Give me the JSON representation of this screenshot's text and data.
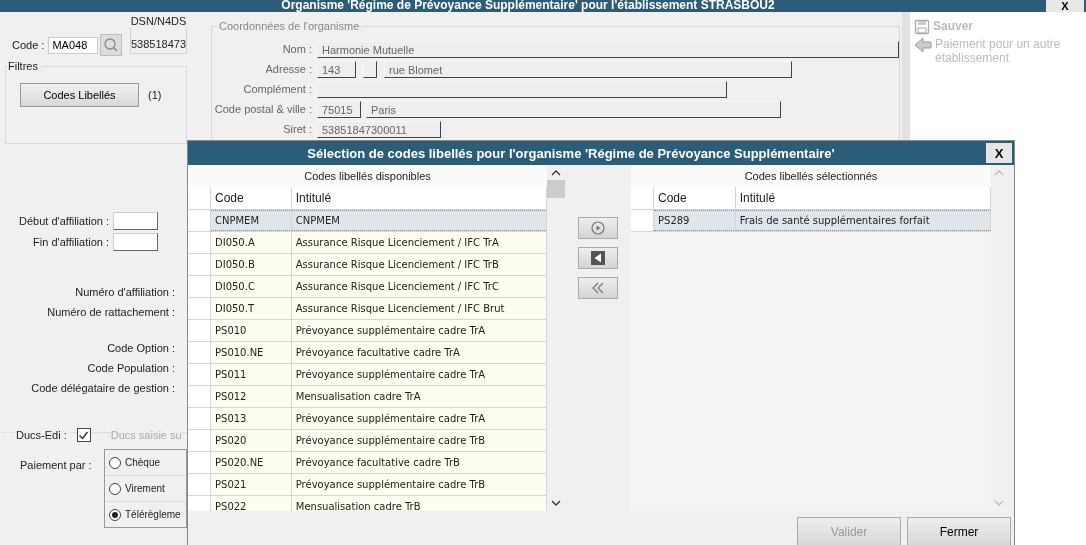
{
  "window": {
    "title": "Organisme 'Régime de Prévoyance Supplémentaire' pour l'établissement STRASBOU2",
    "close": "X"
  },
  "code": {
    "label": "Code :",
    "value": "MA048"
  },
  "dsn": {
    "legend": "DSN/N4DS",
    "value": "538518473"
  },
  "filters": {
    "legend": "Filtres",
    "button": "Codes Libellés",
    "count": "(1)"
  },
  "organisme": {
    "legend": "Coordonnées de l'organisme",
    "fields": [
      {
        "kind": "single",
        "label": "Nom :",
        "values": [
          "Harmonie Mutuelle"
        ]
      },
      {
        "kind": "address",
        "label": "Adresse :",
        "values": [
          "143",
          "rue Blomet"
        ]
      },
      {
        "kind": "empty",
        "label": "Complément :"
      },
      {
        "kind": "split",
        "label": "Code postal & ville :",
        "values": [
          "75015",
          "Paris"
        ]
      },
      {
        "kind": "short",
        "label": "Siret :",
        "values": [
          "53851847300011"
        ]
      }
    ]
  },
  "dates": [
    {
      "label": "Début d'affiliation :"
    },
    {
      "label": "Fin d'affiliation :"
    }
  ],
  "numbers": [
    {
      "label": "Numéro d'affiliation :"
    },
    {
      "label": "Numéro de rattachement :"
    }
  ],
  "options": [
    {
      "label": "Code Option :"
    },
    {
      "label": "Code Population :"
    },
    {
      "label": "Code délégataire de gestion :"
    }
  ],
  "ducs": {
    "label": "Ducs-Edi :",
    "checked": true,
    "other": "Ducs saisie su"
  },
  "payment": {
    "label": "Paiement par :",
    "choices": [
      {
        "label": "Chèque",
        "selected": false
      },
      {
        "label": "Virement",
        "selected": false
      },
      {
        "label": "Télérègleme",
        "selected": true
      }
    ]
  },
  "actions": [
    {
      "kind": "save",
      "label": "Sauver",
      "disabled": true
    },
    {
      "kind": "transfer",
      "label": "Paiement pour un autre établissement",
      "disabled": true
    }
  ],
  "dialog": {
    "title": "Sélection de codes libellés pour l'organisme 'Régime de Prévoyance Supplémentaire'",
    "close": "X",
    "available": {
      "caption": "Codes libellés disponibles",
      "columns": [
        "Code",
        "Intitulé"
      ],
      "rows": [
        {
          "code": "CNPMEM",
          "label": "CNPMEM",
          "selected": true
        },
        {
          "code": "DI050.A",
          "label": "Assurance Risque Licenciement / IFC TrA",
          "selected": false
        },
        {
          "code": "DI050.B",
          "label": "Assurance Risque Licenciement / IFC TrB",
          "selected": false
        },
        {
          "code": "DI050.C",
          "label": "Assurance Risque Licenciement / IFC TrC",
          "selected": false
        },
        {
          "code": "DI050.T",
          "label": "Assurance Risque Licenciement / IFC Brut",
          "selected": false
        },
        {
          "code": "PS010",
          "label": "Prévoyance supplémentaire cadre TrA",
          "selected": false
        },
        {
          "code": "PS010.NE",
          "label": "Prévoyance facultative cadre TrA",
          "selected": false
        },
        {
          "code": "PS011",
          "label": "Prévoyance supplémentaire cadre TrA",
          "selected": false
        },
        {
          "code": "PS012",
          "label": "Mensualisation cadre TrA",
          "selected": false
        },
        {
          "code": "PS013",
          "label": "Prévoyance supplémentaire cadre TrA",
          "selected": false
        },
        {
          "code": "PS020",
          "label": "Prévoyance supplémentaire cadre TrB",
          "selected": false
        },
        {
          "code": "PS020.NE",
          "label": "Prévoyance facultative cadre TrB",
          "selected": false
        },
        {
          "code": "PS021",
          "label": "Prévoyance supplémentaire cadre TrB",
          "selected": false
        },
        {
          "code": "PS022",
          "label": "Mensualisation cadre TrB",
          "selected": false
        }
      ]
    },
    "chosen": {
      "caption": "Codes libellés sélectionnés",
      "columns": [
        "Code",
        "Intitulé"
      ],
      "rows": [
        {
          "code": "PS289",
          "label": "Frais de santé supplémentaires forfait",
          "selected": true
        }
      ]
    },
    "buttons": [
      {
        "label": "Valider",
        "disabled": true
      },
      {
        "label": "Fermer",
        "disabled": false
      }
    ]
  }
}
